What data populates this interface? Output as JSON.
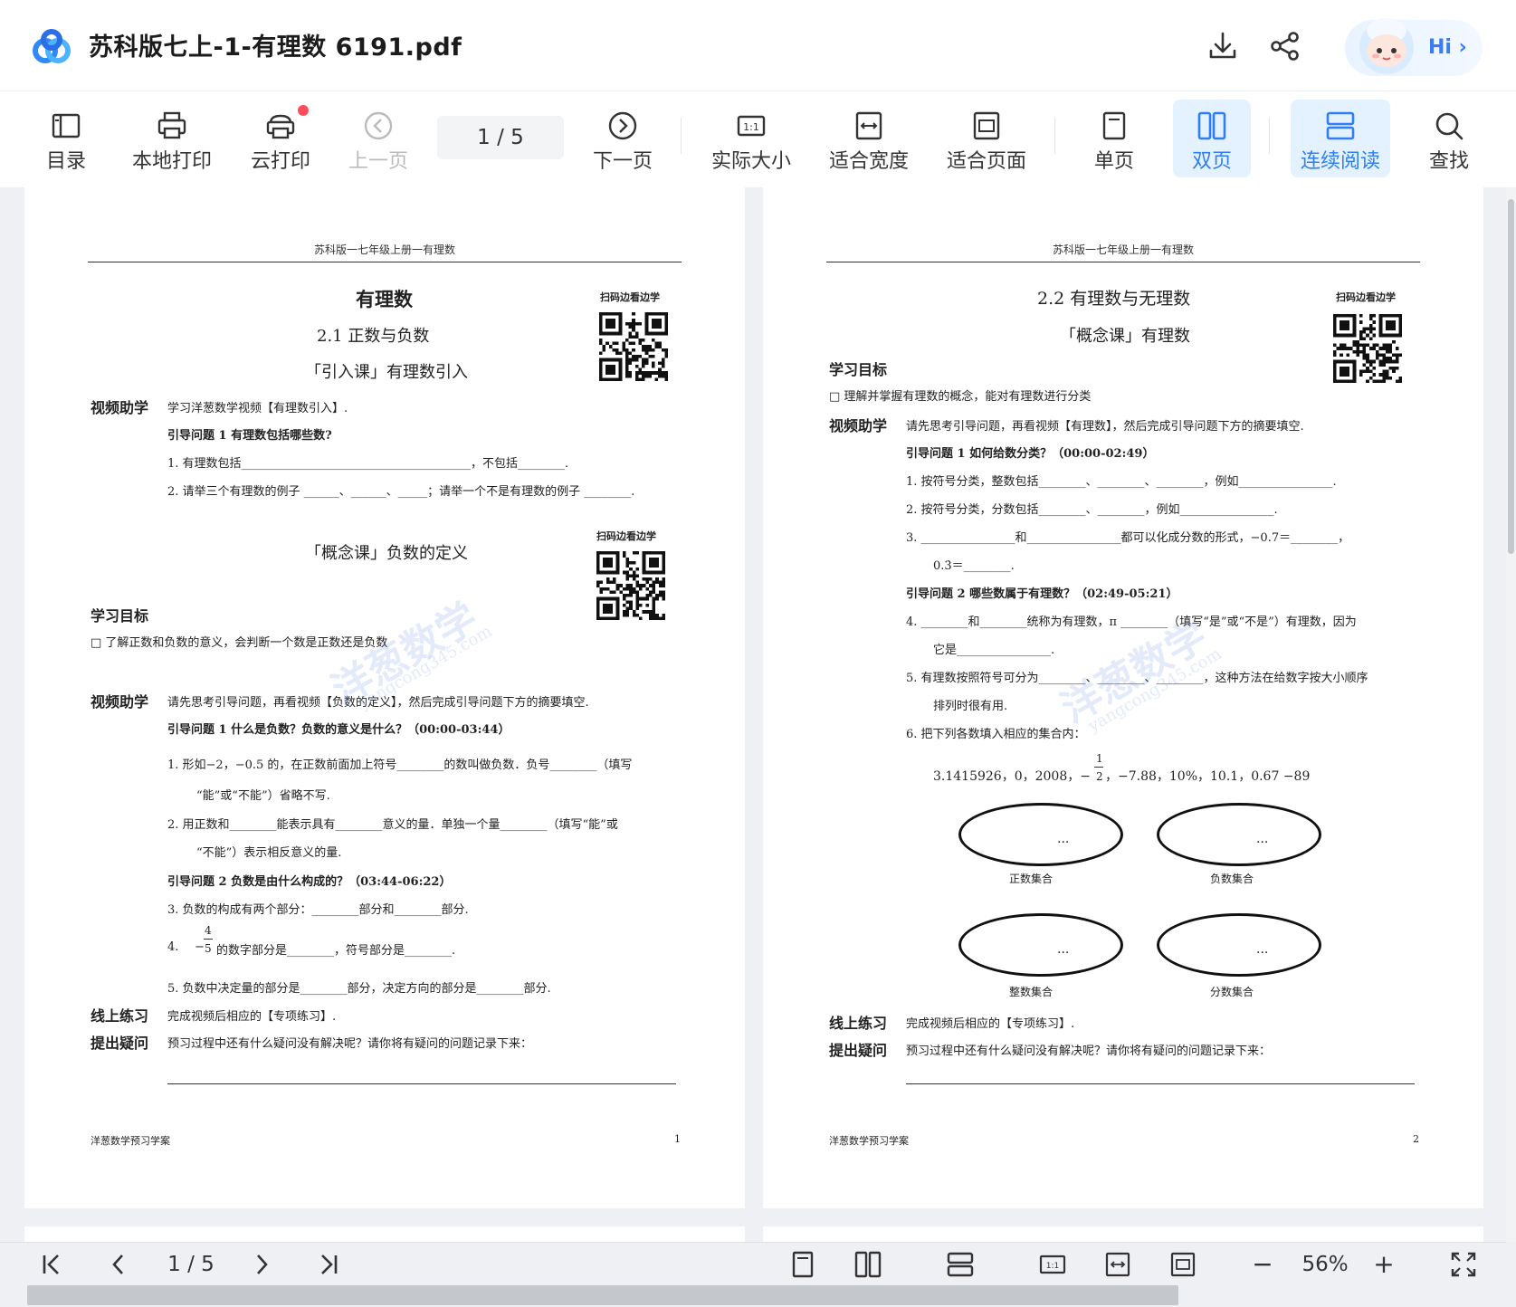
{
  "app": {
    "title": "苏科版七上-1-有理数  6191.pdf",
    "hi_label": "Hi ›"
  },
  "toolbar": {
    "toc": "目录",
    "local_print": "本地打印",
    "cloud_print": "云打印",
    "prev": "上一页",
    "page_indicator": "1  / 5",
    "next": "下一页",
    "actual_size": "实际大小",
    "fit_width": "适合宽度",
    "fit_page": "适合页面",
    "single": "单页",
    "double": "双页",
    "continuous": "连续阅读",
    "search": "查找"
  },
  "page1": {
    "header": "苏科版一七年级上册一有理数",
    "title": "有理数",
    "subtitle": "2.1 正数与负数",
    "lesson1": "「引入课」有理数引入",
    "qr_label1": "扫码边看边学",
    "video_label": "视频助学",
    "video_text1": "学习洋葱数学视频【有理数引入】.",
    "q1_title": "引导问题 1    有理数包括哪些数?",
    "q1_1": "1.    有理数包括_______________________________________，不包括________.",
    "q1_2": "2.    请举三个有理数的例子 ______、______、_____；请举一个不是有理数的例子 ________.",
    "lesson2": "「概念课」负数的定义",
    "qr_label2": "扫码边看边学",
    "goal_label": "学习目标",
    "goal_text": "□   了解正数和负数的意义，会判断一个数是正数还是负数",
    "video_label2": "视频助学",
    "video_text2": "请先思考引导问题，再看视频【负数的定义】，然后完成引导问题下方的摘要填空.",
    "q2_title": "引导问题 1    什么是负数？负数的意义是什么？（00:00-03:44）",
    "q2_1a": "1.    形如−2，−0.5 的，在正数前面加上符号________的数叫做负数．负号________（填写",
    "q2_1b": "“能”或“不能”）省略不写.",
    "q2_2a": "2.    用正数和________能表示具有________意义的量．单独一个量________（填写“能”或",
    "q2_2b": "“不能”）表示相反意义的量.",
    "q3_title": "引导问题 2    负数是由什么构成的？（03:44-06:22）",
    "q3_3": "3.    负数的构成有两个部分：________部分和________部分.",
    "q3_4_num": "4.",
    "q3_4_frac_num": "4",
    "q3_4_frac_den": "5",
    "q3_4_text": "的数字部分是________，符号部分是________.",
    "q3_5": "5.    负数中决定量的部分是________部分，决定方向的部分是________部分.",
    "online_label": "线上练习",
    "online_text": "完成视频后相应的【专项练习】.",
    "ask_label": "提出疑问",
    "ask_text": "预习过程中还有什么疑问没有解决呢？请你将有疑问的问题记录下来：",
    "footer_left": "洋葱数学预习学案",
    "footer_num": "1"
  },
  "page2": {
    "header": "苏科版一七年级上册一有理数",
    "title": "2.2 有理数与无理数",
    "lesson": "「概念课」有理数",
    "qr_label": "扫码边看边学",
    "goal_label": "学习目标",
    "goal_text": "□   理解并掌握有理数的概念，能对有理数进行分类",
    "video_label": "视频助学",
    "video_text": "请先思考引导问题，再看视频【有理数】，然后完成引导问题下方的摘要填空.",
    "q1_title": "引导问题 1    如何给数分类？（00:00-02:49）",
    "q1_1": "1.    按符号分类，整数包括________、________、________，例如________________.",
    "q1_2": "2.    按符号分类，分数包括________、________，例如________________.",
    "q1_3a": "3.    ________________和________________都可以化成分数的形式，−0.7＝________，",
    "q1_3b": "0.3̇＝________.",
    "q2_title": "引导问题 2    哪些数属于有理数？（02:49-05:21）",
    "q2_4a": "4.    ________和________统称为有理数，π ________（填写“是”或“不是”）有理数，因为",
    "q2_4b": "它是________________.",
    "q2_5a": "5.    有理数按照符号可分为________、________、________，这种方法在给数字按大小顺序",
    "q2_5b": "排列时很有用.",
    "q2_6": "6.    把下列各数填入相应的集合内：",
    "numbers_a": "3.1415926，0，2008，−",
    "frac_num": "1",
    "frac_den": "2",
    "numbers_b": "，−7.88，10%，10.1，0.67  −89",
    "set_dots": "...",
    "set1": "正数集合",
    "set2": "负数集合",
    "set3": "整数集合",
    "set4": "分数集合",
    "online_label": "线上练习",
    "online_text": "完成视频后相应的【专项练习】.",
    "ask_label": "提出疑问",
    "ask_text": "预习过程中还有什么疑问没有解决呢？请你将有疑问的问题记录下来：",
    "footer_left": "洋葱数学预习学案",
    "footer_num": "2"
  },
  "watermark": {
    "main": "洋葱数学",
    "sub": "yangcong345.com"
  },
  "bottom": {
    "page_indicator": "1 / 5",
    "zoom": "56%",
    "minus": "−",
    "plus": "+"
  }
}
